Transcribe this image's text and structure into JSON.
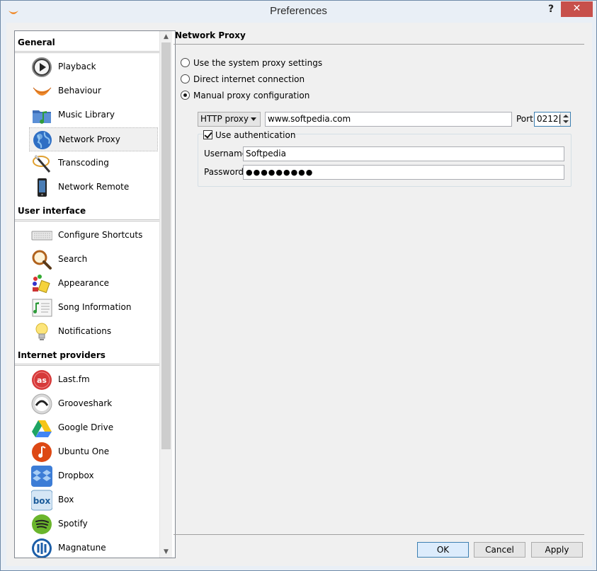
{
  "window": {
    "title": "Preferences",
    "help_label": "?",
    "close_label": "✕"
  },
  "sidebar": {
    "categories": [
      {
        "label": "General",
        "items": [
          {
            "label": "Playback",
            "icon": "play-icon"
          },
          {
            "label": "Behaviour",
            "icon": "clementine-icon"
          },
          {
            "label": "Music Library",
            "icon": "music-folder-icon"
          },
          {
            "label": "Network Proxy",
            "icon": "globe-icon",
            "selected": true
          },
          {
            "label": "Transcoding",
            "icon": "transcode-icon"
          },
          {
            "label": "Network Remote",
            "icon": "phone-icon"
          }
        ]
      },
      {
        "label": "User interface",
        "items": [
          {
            "label": "Configure Shortcuts",
            "icon": "keyboard-icon"
          },
          {
            "label": "Search",
            "icon": "magnifier-icon"
          },
          {
            "label": "Appearance",
            "icon": "paint-icon"
          },
          {
            "label": "Song Information",
            "icon": "song-info-icon"
          },
          {
            "label": "Notifications",
            "icon": "lightbulb-icon"
          }
        ]
      },
      {
        "label": "Internet providers",
        "items": [
          {
            "label": "Last.fm",
            "icon": "lastfm-icon"
          },
          {
            "label": "Grooveshark",
            "icon": "grooveshark-icon"
          },
          {
            "label": "Google Drive",
            "icon": "google-drive-icon"
          },
          {
            "label": "Ubuntu One",
            "icon": "ubuntu-one-icon"
          },
          {
            "label": "Dropbox",
            "icon": "dropbox-icon"
          },
          {
            "label": "Box",
            "icon": "box-icon"
          },
          {
            "label": "Spotify",
            "icon": "spotify-icon"
          },
          {
            "label": "Magnatune",
            "icon": "magnatune-icon"
          }
        ]
      }
    ]
  },
  "proxy": {
    "section_title": "Network Proxy",
    "options": [
      {
        "label": "Use the system proxy settings",
        "checked": false
      },
      {
        "label": "Direct internet connection",
        "checked": false
      },
      {
        "label": "Manual proxy configuration",
        "checked": true
      }
    ],
    "type_value": "HTTP proxy",
    "host_value": "www.softpedia.com",
    "port_label": "Port",
    "port_value": "0212",
    "auth_label": "Use authentication",
    "username_label": "Username",
    "username_value": "Softpedia",
    "password_label": "Password",
    "password_value": "●●●●●●●●●"
  },
  "buttons": {
    "ok": "OK",
    "cancel": "Cancel",
    "apply": "Apply"
  },
  "colors": {
    "close": "#c7504b",
    "accent": "#3c7fb1",
    "window_bg": "#e9eff6"
  }
}
